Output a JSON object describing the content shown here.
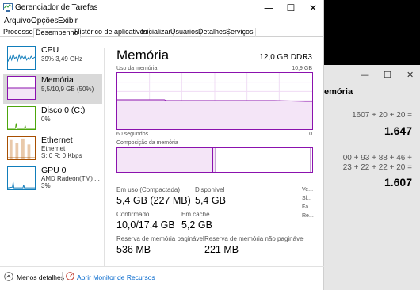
{
  "window": {
    "title": "Gerenciador de Tarefas",
    "minimize": "—",
    "maximize": "☐",
    "close": "✕"
  },
  "menu": [
    "Arquivo",
    "Opções",
    "Exibir"
  ],
  "tabs": [
    "Processos",
    "Desempenho",
    "Histórico de aplicativos",
    "Inicializar",
    "Usuários",
    "Detalhes",
    "Serviços"
  ],
  "active_tab": "Desempenho",
  "sidebar": {
    "items": [
      {
        "title": "CPU",
        "sub1": "39% 3,49 GHz",
        "sub2": "",
        "color": "#117dbb"
      },
      {
        "title": "Memória",
        "sub1": "5,5/10,9 GB (50%)",
        "sub2": "",
        "color": "#8b12ae"
      },
      {
        "title": "Disco 0 (C:)",
        "sub1": "0%",
        "sub2": "",
        "color": "#4da60c"
      },
      {
        "title": "Ethernet",
        "sub1": "Ethernet",
        "sub2": "S: 0 R: 0 Kbps",
        "color": "#a74f01"
      },
      {
        "title": "GPU 0",
        "sub1": "AMD Radeon(TM) ...",
        "sub2": "3%",
        "color": "#117dbb"
      }
    ]
  },
  "main": {
    "title": "Memória",
    "spec": "12,0 GB DDR3",
    "usage_label": "Uso da memória",
    "usage_max": "10,9 GB",
    "seconds_label": "60 segundos",
    "zero_label": "0",
    "composition_label": "Composição da memória",
    "stats": {
      "in_use_label": "Em uso (Compactada)",
      "in_use_value": "5,4 GB (227 MB)",
      "available_label": "Disponível",
      "available_value": "5,4 GB",
      "committed_label": "Confirmado",
      "committed_value": "10,0/17,4 GB",
      "cached_label": "Em cache",
      "cached_value": "5,2 GB",
      "paged_label": "Reserva de memória paginável",
      "paged_value": "536 MB",
      "nonpaged_label": "Reserva de memória não paginável",
      "nonpaged_value": "221 MB"
    },
    "side_truncated": [
      "Ve...",
      "Sl...",
      "Fa...",
      "Re..."
    ]
  },
  "footer": {
    "less_details": "Menos detalhes",
    "resource_monitor": "Abrir Monitor de Recursos"
  },
  "calculator": {
    "title": "emória",
    "line1": "1607  +  20  +  20 =",
    "result1": "1.647",
    "line2a": "00  +  93  +  88  +  46  +",
    "line2b": "23  +  22  +  22  +  20 =",
    "result2": "1.607",
    "minimize": "—",
    "maximize": "☐",
    "close": "✕"
  },
  "colors": {
    "memory_accent": "#8b12ae",
    "cpu_accent": "#117dbb",
    "disk_accent": "#4da60c",
    "ethernet_accent": "#a74f01",
    "link_blue": "#0066cc"
  }
}
